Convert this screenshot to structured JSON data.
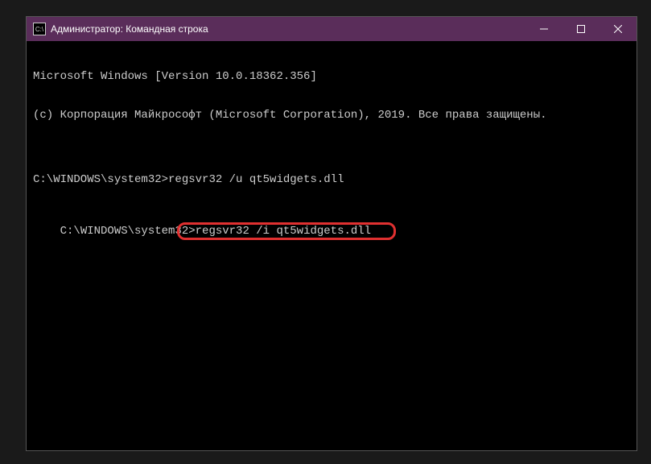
{
  "titlebar": {
    "icon_label": "cmd-icon",
    "title": "Администратор: Командная строка"
  },
  "terminal": {
    "line1": "Microsoft Windows [Version 10.0.18362.356]",
    "line2": "(c) Корпорация Майкрософт (Microsoft Corporation), 2019. Все права защищены.",
    "blank": "",
    "prompt1": "C:\\WINDOWS\\system32>",
    "cmd1": "regsvr32 /u qt5widgets.dll",
    "prompt2": "C:\\WINDOWS\\system32>",
    "cmd2": "regsvr32 /i qt5widgets.dll"
  },
  "highlight": {
    "target_command": "regsvr32 /i qt5widgets.dll"
  }
}
